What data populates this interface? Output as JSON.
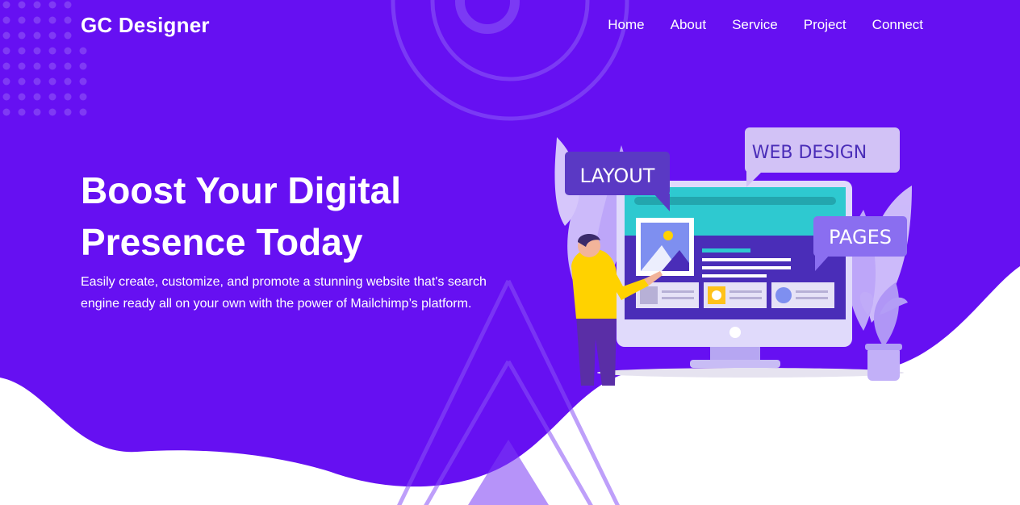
{
  "brand": {
    "name": "GC Designer"
  },
  "nav": {
    "items": [
      {
        "label": "Home"
      },
      {
        "label": "About"
      },
      {
        "label": "Service"
      },
      {
        "label": "Project"
      },
      {
        "label": "Connect"
      }
    ]
  },
  "hero": {
    "title_line1": "Boost Your Digital",
    "title_line2": "Presence Today",
    "description": "Easily create, customize, and promote a stunning website that's search engine ready all on your own with the power of Mailchimp’s platform."
  },
  "illustration": {
    "tags": {
      "layout": "LAYOUT",
      "web_design": "WEB DESIGN",
      "pages": "PAGES"
    }
  },
  "colors": {
    "primary": "#6610f2",
    "accent_teal": "#2ec9d0",
    "accent_yellow": "#ffd200"
  }
}
